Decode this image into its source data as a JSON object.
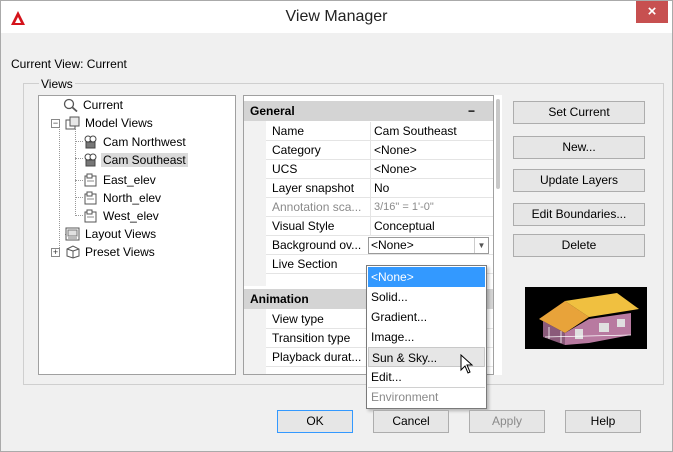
{
  "window": {
    "title": "View Manager",
    "close_glyph": "×"
  },
  "current_view_label": "Current View: Current",
  "views_group_label": "Views",
  "tree": {
    "items": [
      {
        "label": "Current",
        "icon": "magnifier-icon"
      },
      {
        "label": "Model Views",
        "icon": "model-views-icon"
      },
      {
        "label": "Cam Northwest",
        "icon": "camera-icon"
      },
      {
        "label": "Cam Southeast",
        "icon": "camera-icon",
        "selected": true
      },
      {
        "label": "East_elev",
        "icon": "view-icon"
      },
      {
        "label": "North_elev",
        "icon": "view-icon"
      },
      {
        "label": "West_elev",
        "icon": "view-icon"
      },
      {
        "label": "Layout Views",
        "icon": "layout-views-icon"
      },
      {
        "label": "Preset Views",
        "icon": "preset-views-icon"
      }
    ],
    "expand_minus": "−",
    "expand_plus": "+"
  },
  "properties": {
    "general": {
      "header": "General",
      "collapse": "−",
      "rows": [
        {
          "name": "Name",
          "value": "Cam Southeast"
        },
        {
          "name": "Category",
          "value": "<None>"
        },
        {
          "name": "UCS",
          "value": "<None>"
        },
        {
          "name": "Layer snapshot",
          "value": "No"
        },
        {
          "name": "Annotation sca...",
          "value": "3/16\" = 1'-0\""
        },
        {
          "name": "Visual Style",
          "value": "Conceptual"
        },
        {
          "name": "Background ov...",
          "value": "<None>"
        },
        {
          "name": "Live Section",
          "value": ""
        }
      ]
    },
    "animation": {
      "header": "Animation",
      "rows": [
        {
          "name": "View type"
        },
        {
          "name": "Transition type"
        },
        {
          "name": "Playback durat..."
        }
      ]
    }
  },
  "dropdown": {
    "options": [
      "<None>",
      "Solid...",
      "Gradient...",
      "Image...",
      "Sun & Sky...",
      "Edit...",
      "Environment"
    ],
    "selected": "<None>",
    "hovered": "Sun & Sky...",
    "disabled": "Environment"
  },
  "buttons": {
    "set_current": "Set Current",
    "new": "New...",
    "update_layers": "Update Layers",
    "edit_boundaries": "Edit Boundaries...",
    "delete": "Delete",
    "ok": "OK",
    "cancel": "Cancel",
    "apply": "Apply",
    "help": "Help"
  },
  "colors": {
    "accent": "#3399ff",
    "close": "#c75050",
    "app_icon": "#d4131b"
  }
}
